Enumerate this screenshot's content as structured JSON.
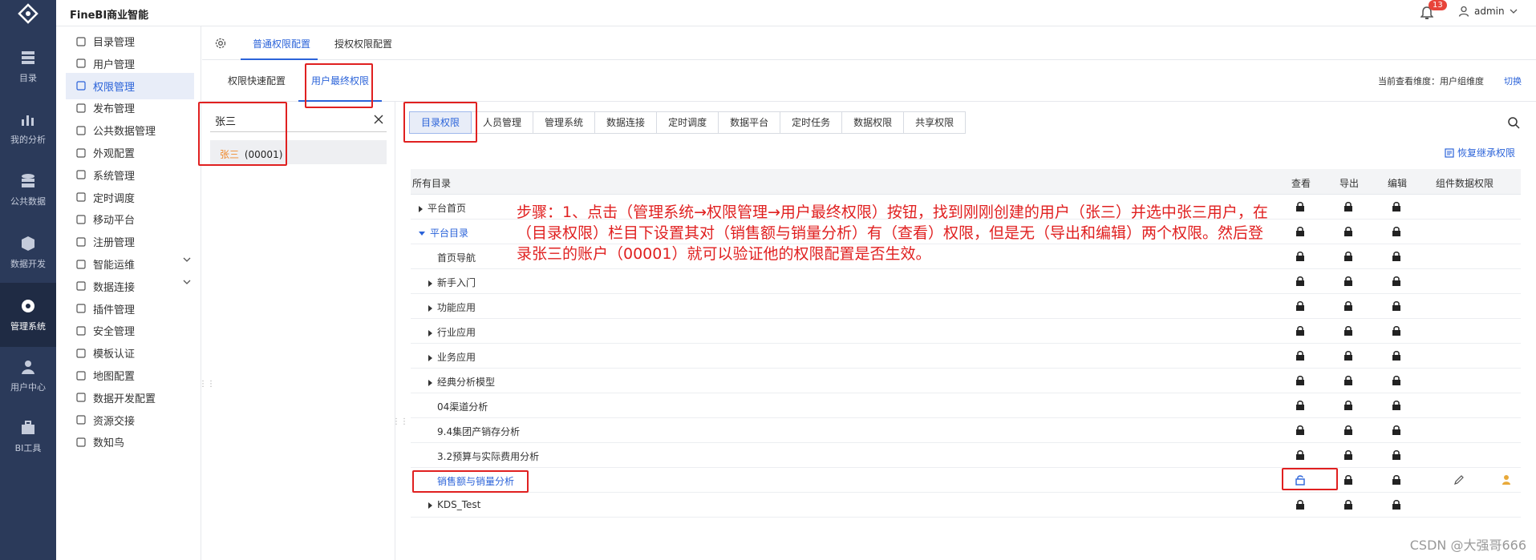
{
  "app": {
    "title": "FineBI商业智能",
    "notification_count": "13",
    "user": "admin"
  },
  "nav": [
    {
      "label": "目录",
      "icon": "directory-icon"
    },
    {
      "label": "我的分析",
      "icon": "analysis-icon"
    },
    {
      "label": "公共数据",
      "icon": "database-icon"
    },
    {
      "label": "数据开发",
      "icon": "cube-icon"
    },
    {
      "label": "管理系统",
      "icon": "gear-icon",
      "active": true
    },
    {
      "label": "用户中心",
      "icon": "user-icon"
    },
    {
      "label": "BI工具",
      "icon": "toolbox-icon"
    }
  ],
  "sidebar": {
    "items": [
      {
        "label": "目录管理"
      },
      {
        "label": "用户管理"
      },
      {
        "label": "权限管理",
        "active": true
      },
      {
        "label": "发布管理"
      },
      {
        "label": "公共数据管理"
      },
      {
        "label": "外观配置"
      },
      {
        "label": "系统管理"
      },
      {
        "label": "定时调度"
      },
      {
        "label": "移动平台"
      },
      {
        "label": "注册管理"
      },
      {
        "label": "智能运维",
        "expand": true
      },
      {
        "label": "数据连接",
        "expand": true
      },
      {
        "label": "插件管理"
      },
      {
        "label": "安全管理"
      },
      {
        "label": "模板认证"
      },
      {
        "label": "地图配置"
      },
      {
        "label": "数据开发配置"
      },
      {
        "label": "资源交接"
      },
      {
        "label": "数知鸟"
      }
    ]
  },
  "tabs": {
    "general": "普通权限配置",
    "grant": "授权权限配置"
  },
  "subtabs": {
    "quick": "权限快速配置",
    "final": "用户最终权限"
  },
  "scope": {
    "label": "当前查看维度：用户组维度",
    "switch": "切换"
  },
  "search": {
    "value": "张三"
  },
  "result": {
    "name": "张三",
    "id": "(00001)"
  },
  "categories": [
    "目录权限",
    "人员管理",
    "管理系统",
    "数据连接",
    "定时调度",
    "数据平台",
    "定时任务",
    "数据权限",
    "共享权限"
  ],
  "inherit_label": "恢复继承权限",
  "table": {
    "headers": {
      "name": "所有目录",
      "view": "查看",
      "export": "导出",
      "edit": "编辑",
      "component": "组件数据权限"
    },
    "rows": [
      {
        "name": "平台首页",
        "indent": 0,
        "expander": "right"
      },
      {
        "name": "平台目录",
        "indent": 0,
        "expander": "down",
        "link": true
      },
      {
        "name": "首页导航",
        "indent": 1,
        "expander": "none"
      },
      {
        "name": "新手入门",
        "indent": 1,
        "expander": "right"
      },
      {
        "name": "功能应用",
        "indent": 1,
        "expander": "right"
      },
      {
        "name": "行业应用",
        "indent": 1,
        "expander": "right"
      },
      {
        "name": "业务应用",
        "indent": 1,
        "expander": "right"
      },
      {
        "name": "经典分析模型",
        "indent": 1,
        "expander": "right"
      },
      {
        "name": "04渠道分析",
        "indent": 1,
        "expander": "none"
      },
      {
        "name": "9.4集团产销存分析",
        "indent": 1,
        "expander": "none"
      },
      {
        "name": "3.2预算与实际费用分析",
        "indent": 1,
        "expander": "none"
      },
      {
        "name": "销售额与销量分析",
        "indent": 1,
        "expander": "none",
        "link": true,
        "view_unlocked": true,
        "component": true
      },
      {
        "name": "KDS_Test",
        "indent": 1,
        "expander": "right"
      }
    ]
  },
  "annotation": "步骤：1、点击（管理系统→权限管理→用户最终权限）按钮，找到刚刚创建的用户（张三）并选中张三用户，在（目录权限）栏目下设置其对（销售额与销量分析）有（查看）权限，但是无（导出和编辑）两个权限。然后登录张三的账户（00001）就可以验证他的权限配置是否生效。",
  "watermark": "CSDN @大强哥666"
}
